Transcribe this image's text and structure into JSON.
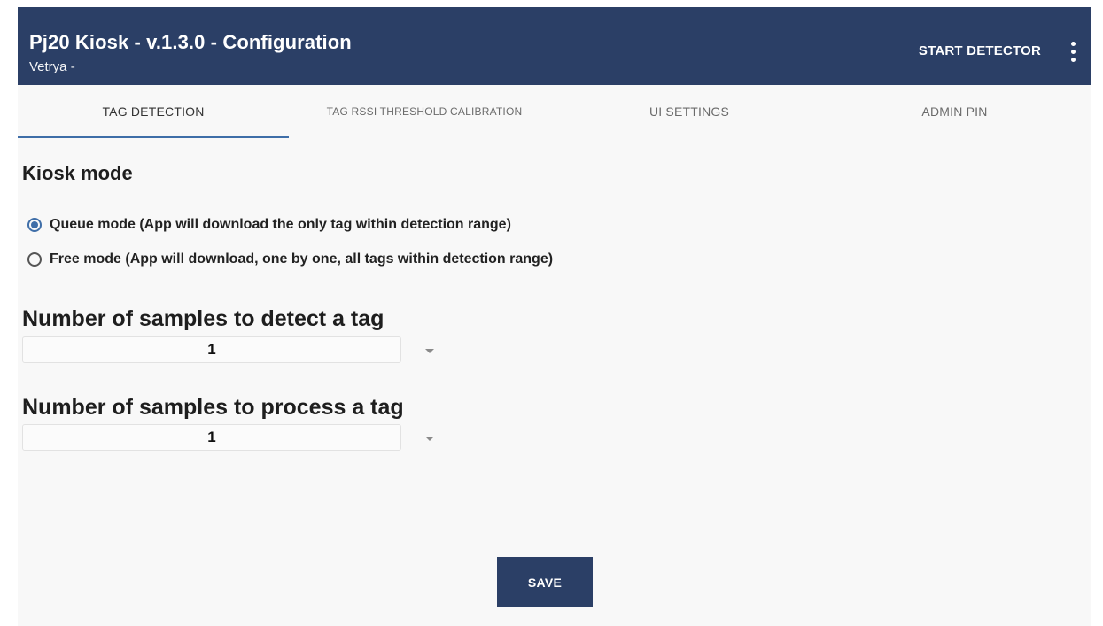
{
  "appbar": {
    "title": "Pj20 Kiosk - v.1.3.0 - Configuration",
    "subtitle": "Vetrya -",
    "start_label": "START DETECTOR",
    "more_icon": "more-vert-icon"
  },
  "tabs": [
    {
      "label": "TAG DETECTION",
      "active": true
    },
    {
      "label": "TAG RSSI THRESHOLD CALIBRATION",
      "active": false
    },
    {
      "label": "UI SETTINGS",
      "active": false
    },
    {
      "label": "ADMIN PIN",
      "active": false
    }
  ],
  "kiosk": {
    "heading": "Kiosk mode",
    "options": [
      {
        "label": "Queue mode (App will download the only tag within detection range)",
        "checked": true
      },
      {
        "label": "Free mode (App will download, one by one, all tags within detection range)",
        "checked": false
      }
    ]
  },
  "detect": {
    "heading": "Number of samples to detect a tag",
    "value": "1"
  },
  "process": {
    "heading": "Number of samples to process a tag",
    "value": "1"
  },
  "save_label": "SAVE",
  "colors": {
    "primary": "#2b3f66",
    "accent": "#3f6ea8"
  }
}
